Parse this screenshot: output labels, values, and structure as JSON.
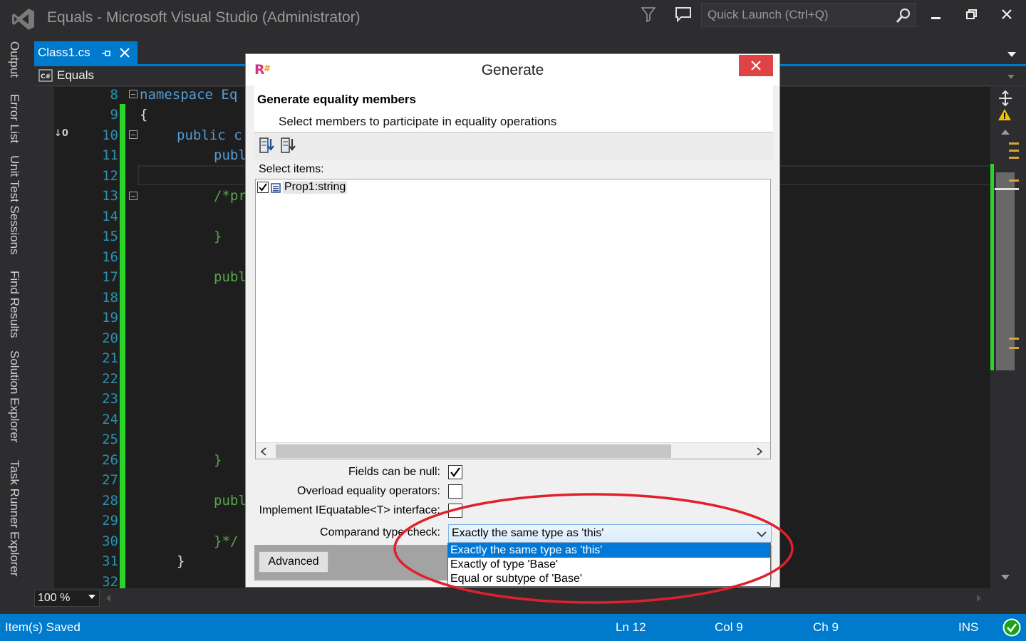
{
  "window": {
    "title": "Equals - Microsoft Visual Studio (Administrator)",
    "quick_launch_placeholder": "Quick Launch (Ctrl+Q)"
  },
  "left_tool_tabs": [
    "Output",
    "Error List",
    "Unit Test Sessions",
    "Find Results",
    "Solution Explorer",
    "Task Runner Explorer"
  ],
  "document_tab": {
    "label": "Class1.cs"
  },
  "navbar": {
    "project": "Equals"
  },
  "editor": {
    "indicator": "↓0",
    "line_numbers": [
      "8",
      "9",
      "10",
      "11",
      "12",
      "13",
      "14",
      "15",
      "16",
      "17",
      "18",
      "19",
      "20",
      "21",
      "22",
      "23",
      "24",
      "25",
      "26",
      "27",
      "28",
      "29",
      "30",
      "31",
      "32"
    ],
    "code": {
      "l8": "namespace Eq",
      "l9": "{",
      "l10": "public c",
      "l11": "publ",
      "l13": "/*pr",
      "l15": "}",
      "l17": "publ",
      "l26": "}",
      "l28": "publ",
      "l30": "}*/",
      "l31": "}"
    }
  },
  "zoom": {
    "value": "100 %"
  },
  "statusbar": {
    "message": "Item(s) Saved",
    "line": "Ln 12",
    "col": "Col 9",
    "ch": "Ch 9",
    "mode": "INS"
  },
  "dialog": {
    "title": "Generate",
    "heading": "Generate equality members",
    "subheading": "Select members to participate in equality operations",
    "select_label": "Select items:",
    "items": [
      {
        "label": "Prop1:string",
        "checked": true
      }
    ],
    "options": {
      "fields_null": {
        "label": "Fields can be null:",
        "checked": true
      },
      "overload_ops": {
        "label": "Overload equality operators:",
        "checked": false
      },
      "iequatable": {
        "label": "Implement IEquatable<T> interface:",
        "checked": false
      },
      "comparand": {
        "label": "Comparand type check:",
        "value": "Exactly the same type as 'this'"
      }
    },
    "advanced_label": "Advanced",
    "dropdown_options": [
      "Exactly the same type as 'this'",
      "Exactly of type 'Base'",
      "Equal or subtype of 'Base'"
    ]
  },
  "colors": {
    "accent": "#007acc",
    "change_bar": "#2bd42b",
    "annotation": "#e0202a",
    "selection": "#0078d7"
  }
}
